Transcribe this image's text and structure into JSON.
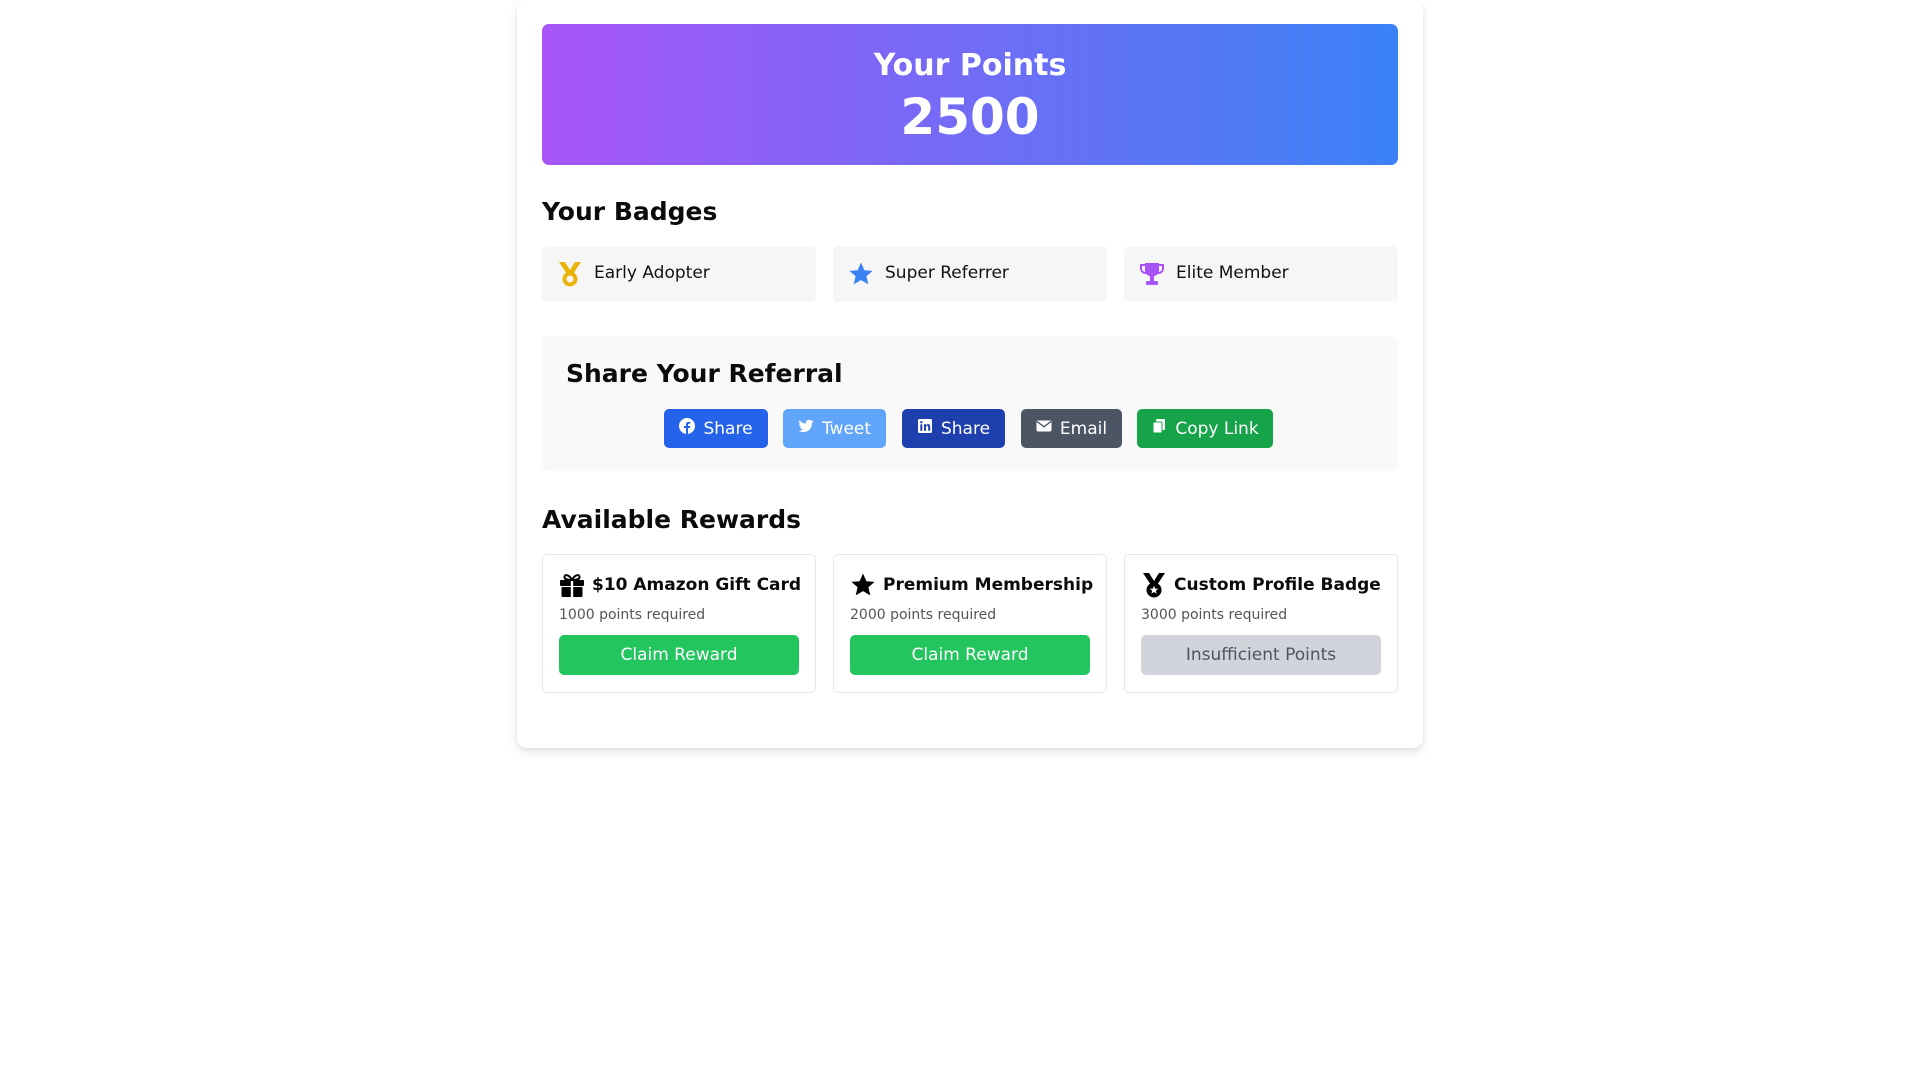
{
  "points": {
    "label": "Your Points",
    "value": "2500"
  },
  "badges": {
    "title": "Your Badges",
    "items": [
      {
        "label": "Early Adopter",
        "icon": "medal-icon",
        "color": "#eab308"
      },
      {
        "label": "Super Referrer",
        "icon": "star-icon",
        "color": "#3b82f6"
      },
      {
        "label": "Elite Member",
        "icon": "trophy-icon",
        "color": "#a855f7"
      }
    ]
  },
  "share": {
    "title": "Share Your Referral",
    "buttons": [
      {
        "label": "Share",
        "icon": "facebook-icon",
        "color": "#2563eb"
      },
      {
        "label": "Tweet",
        "icon": "twitter-icon",
        "color": "#60a5fa"
      },
      {
        "label": "Share",
        "icon": "linkedin-icon",
        "color": "#1e40af"
      },
      {
        "label": "Email",
        "icon": "envelope-icon",
        "color": "#4b5563"
      },
      {
        "label": "Copy Link",
        "icon": "copy-icon",
        "color": "#16a34a"
      }
    ]
  },
  "rewards": {
    "title": "Available Rewards",
    "items": [
      {
        "title": "$10 Amazon Gift Card",
        "points": "1000 points required",
        "button": "Claim Reward",
        "icon": "gift-icon",
        "available": true
      },
      {
        "title": "Premium Membership",
        "points": "2000 points required",
        "button": "Claim Reward",
        "icon": "star-icon",
        "available": true
      },
      {
        "title": "Custom Profile Badge",
        "points": "3000 points required",
        "button": "Insufficient Points",
        "icon": "medal-icon",
        "available": false
      }
    ]
  },
  "colors": {
    "gradient_start": "#a855f7",
    "gradient_end": "#3b82f6",
    "claim_button": "#22c55e",
    "disabled_button": "#d1d5db"
  }
}
